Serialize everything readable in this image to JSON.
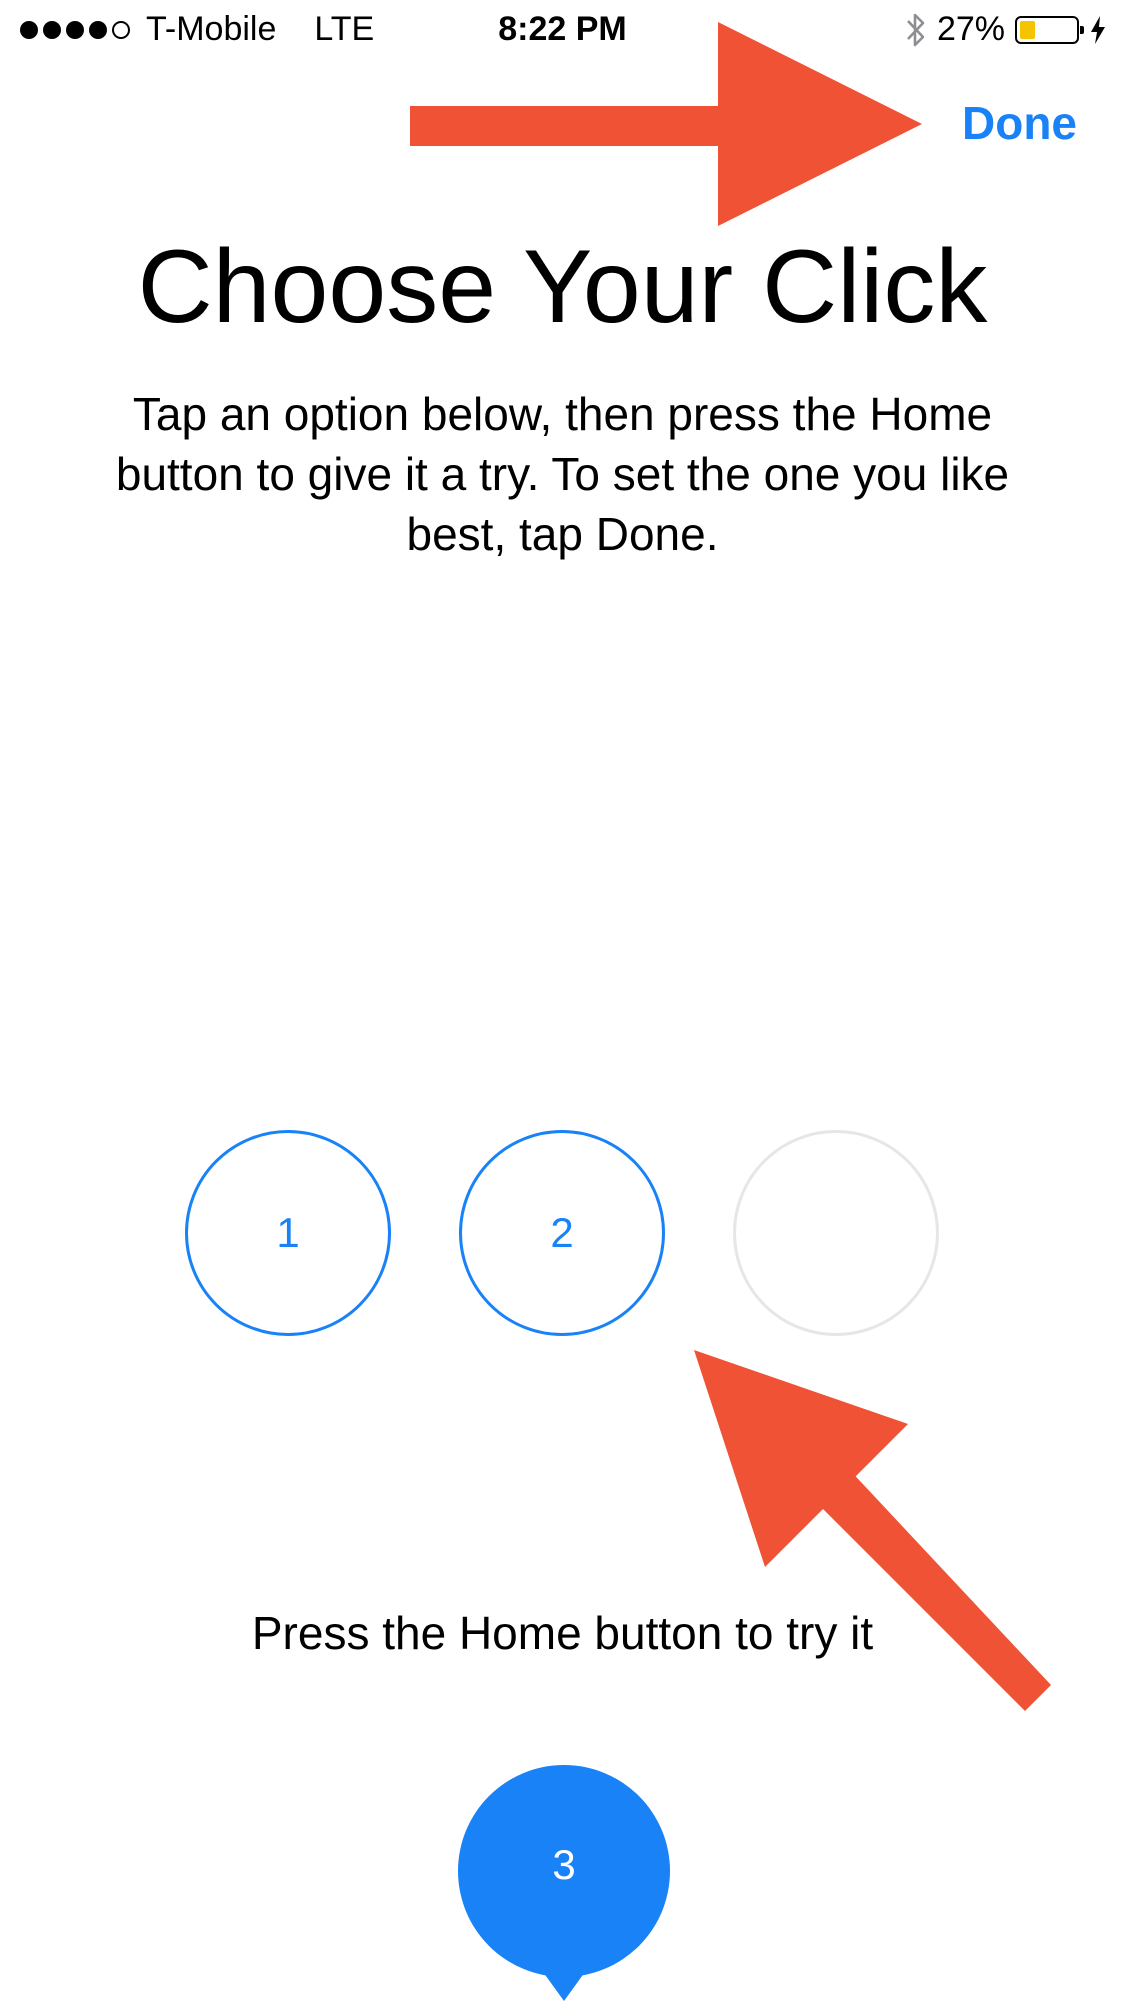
{
  "status_bar": {
    "carrier": "T-Mobile",
    "network": "LTE",
    "time": "8:22 PM",
    "battery_percent": "27%",
    "battery_level": 0.27,
    "signal_bars_filled": 4,
    "signal_bars_total": 5
  },
  "nav": {
    "done_label": "Done"
  },
  "header": {
    "title": "Choose Your Click",
    "instructions": "Tap an option below, then press the Home button to give it a try. To set the one you like best, tap Done."
  },
  "options": [
    {
      "label": "1"
    },
    {
      "label": "2"
    },
    {
      "label": ""
    }
  ],
  "home_press": {
    "hint": "Press the Home button to try it",
    "selected_label": "3"
  },
  "colors": {
    "accent": "#1a82f7",
    "annotation_arrow": "#ef5234",
    "inactive_ring": "#e6e6e6"
  }
}
